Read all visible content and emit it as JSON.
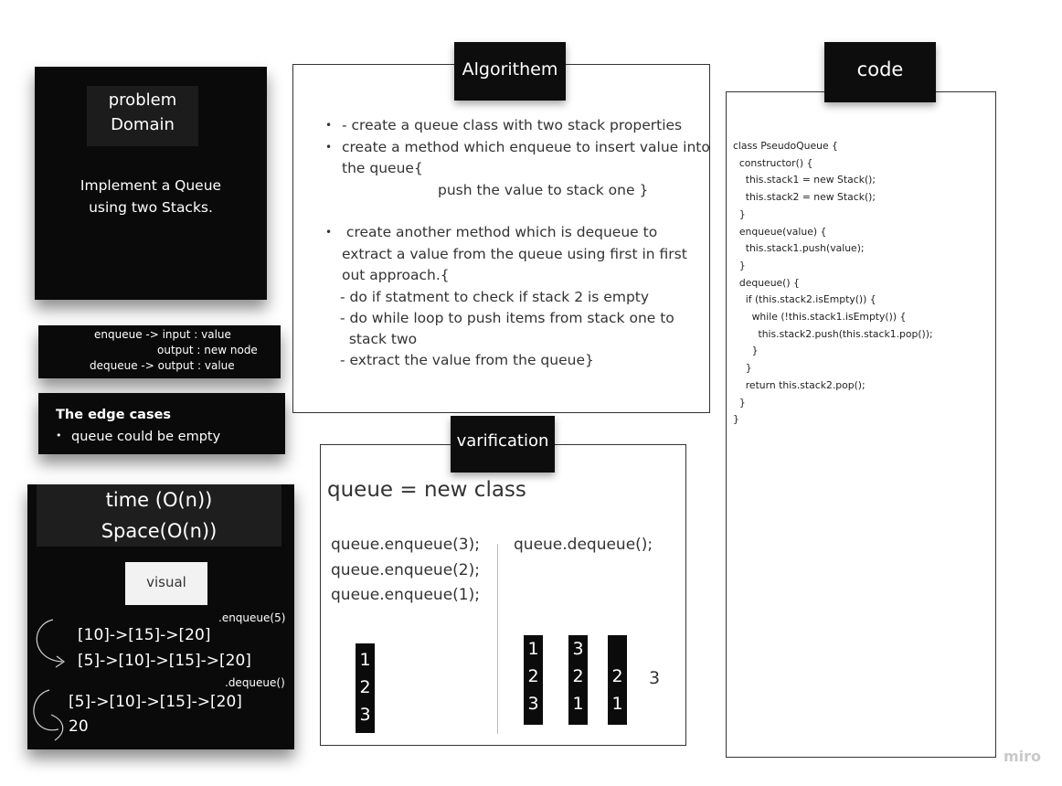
{
  "problem_domain": {
    "title_line1": "problem",
    "title_line2": "Domain",
    "desc_line1": "Implement a Queue",
    "desc_line2": "using two Stacks."
  },
  "signatures": {
    "line1": "enqueue -> input : value",
    "line2": "output : new node",
    "line3": "dequeue -> output : value"
  },
  "edge_cases": {
    "heading": "The edge cases",
    "item": "queue could be empty"
  },
  "complexity": {
    "time": "time (O(n))",
    "space": "Space(O(n))",
    "visual_label": "visual",
    "enqueue_label": ".enqueue(5)",
    "enqueue_before": "[10]->[15]->[20]",
    "enqueue_after": "[5]->[10]->[15]->[20]",
    "dequeue_label": ".dequeue()",
    "dequeue_before": "[5]->[10]->[15]->[20]",
    "dequeue_result": "20"
  },
  "algorithm": {
    "title": "Algorithem",
    "b1": "- create a queue class with two stack properties",
    "b2_l1": "create a method which enqueue to insert value into",
    "b2_l2": "the queue{",
    "b2_l3": "push the value to stack one }",
    "b3_l1": " create another method which is dequeue to",
    "b3_l2": "extract a value from the queue using first in first",
    "b3_l3": "out approach.{",
    "b3_l4": "- do if statment to check if stack 2 is empty",
    "b3_l5": "- do while loop to push items from stack one to",
    "b3_l6": "  stack two",
    "b3_l7": "- extract the value from the queue}"
  },
  "verification": {
    "title": "varification",
    "decl": "queue = new class",
    "enq1": "queue.enqueue(3);",
    "enq2": "queue.enqueue(2);",
    "enq3": "queue.enqueue(1);",
    "deq": "queue.dequeue();",
    "stack_a": [
      "1",
      "2",
      "3"
    ],
    "stack_b": [
      "1",
      "2",
      "3"
    ],
    "stack_c": [
      "3",
      "2",
      "1"
    ],
    "stack_d": [
      "2",
      "1"
    ],
    "result": "3"
  },
  "code": {
    "title": "code",
    "source": "class PseudoQueue {\n  constructor() {\n    this.stack1 = new Stack();\n    this.stack2 = new Stack();\n  }\n  enqueue(value) {\n    this.stack1.push(value);\n  }\n  dequeue() {\n    if (this.stack2.isEmpty()) {\n      while (!this.stack1.isEmpty()) {\n        this.stack2.push(this.stack1.pop());\n      }\n    }\n    return this.stack2.pop();\n  }\n}"
  },
  "watermark": "miro"
}
